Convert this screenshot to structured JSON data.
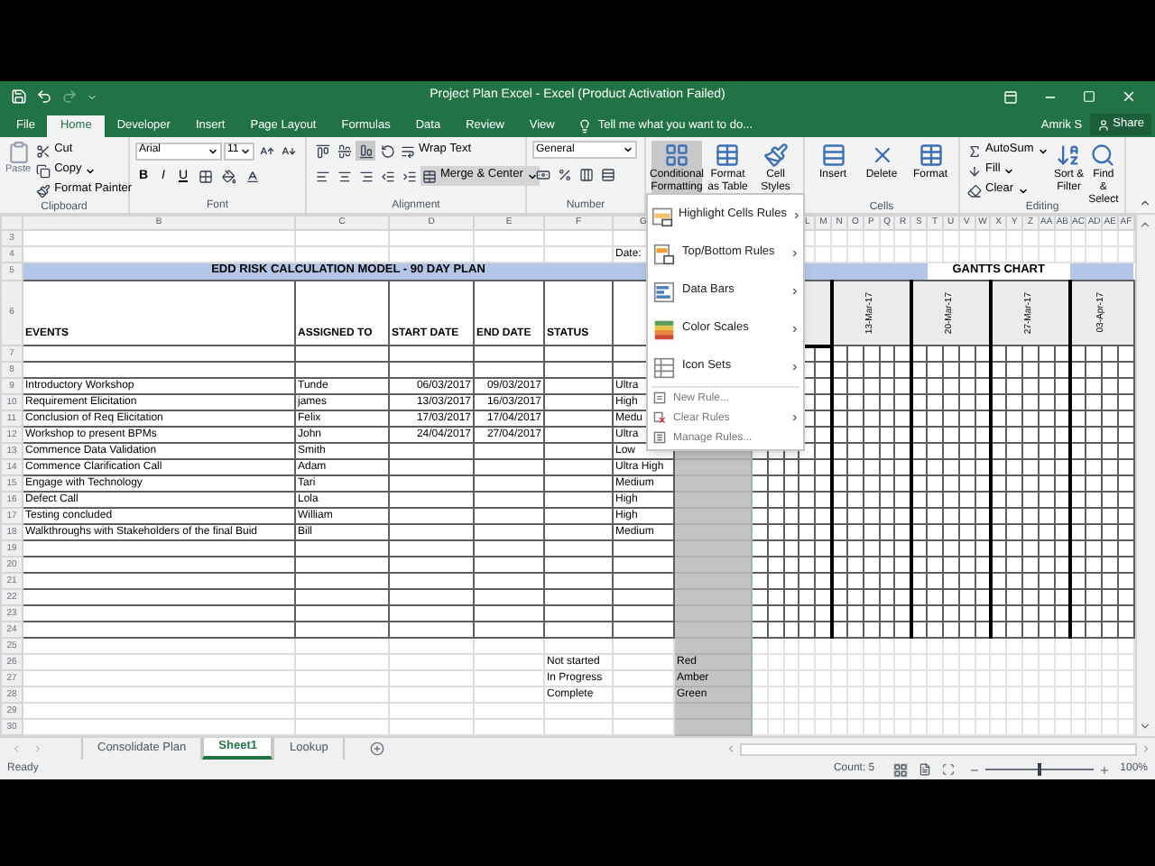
{
  "window": {
    "title": "Project Plan Excel - Excel (Product Activation Failed)",
    "user": "Amrik S",
    "share": "Share"
  },
  "ribbon_tabs": [
    {
      "label": "File",
      "selected": false
    },
    {
      "label": "Home",
      "selected": true
    },
    {
      "label": "Developer",
      "selected": false
    },
    {
      "label": "Insert",
      "selected": false
    },
    {
      "label": "Page Layout",
      "selected": false
    },
    {
      "label": "Formulas",
      "selected": false
    },
    {
      "label": "Data",
      "selected": false
    },
    {
      "label": "Review",
      "selected": false
    },
    {
      "label": "View",
      "selected": false
    }
  ],
  "tell_me": "Tell me what you want to do...",
  "clipboard": {
    "paste": "Paste",
    "cut": "Cut",
    "copy": "Copy",
    "format_painter": "Format Painter",
    "label": "Clipboard"
  },
  "font": {
    "name": "Arial",
    "size": "11",
    "bold": "B",
    "italic": "I",
    "underline": "U",
    "label": "Font"
  },
  "alignment": {
    "wrap_text": "Wrap Text",
    "merge_center": "Merge & Center",
    "label": "Alignment"
  },
  "number": {
    "format": "General",
    "label": "Number"
  },
  "styles": {
    "conditional_formatting": "Conditional Formatting",
    "conditional_formatting_open": true,
    "format_as_table": "Format as Table",
    "cell_styles": "Cell Styles"
  },
  "cells": {
    "insert": "Insert",
    "delete": "Delete",
    "format": "Format",
    "label": "Cells"
  },
  "editing": {
    "autosum": "AutoSum",
    "fill": "Fill",
    "clear": "Clear",
    "sort_filter": "Sort & Filter",
    "find_select": "Find & Select",
    "label": "Editing"
  },
  "cf_menu": [
    {
      "kind": "large",
      "label": "Highlight Cells Rules",
      "submenu": true
    },
    {
      "kind": "large",
      "label": "Top/Bottom Rules",
      "submenu": true
    },
    {
      "kind": "large",
      "label": "Data Bars",
      "submenu": true
    },
    {
      "kind": "large",
      "label": "Color Scales",
      "submenu": true
    },
    {
      "kind": "large",
      "label": "Icon Sets",
      "submenu": true
    },
    {
      "kind": "small",
      "label": "New Rule...",
      "submenu": false
    },
    {
      "kind": "small",
      "label": "Clear Rules",
      "submenu": true
    },
    {
      "kind": "small",
      "label": "Manage Rules...",
      "submenu": false
    }
  ],
  "columns": [
    "B",
    "C",
    "D",
    "E",
    "F",
    "G"
  ],
  "gantt_columns": [
    "L",
    "M",
    "N",
    "O",
    "P",
    "Q",
    "R",
    "S",
    "T",
    "U",
    "V",
    "W",
    "X",
    "Y",
    "Z",
    "AA",
    "AB",
    "AC",
    "AD",
    "AE",
    "AF"
  ],
  "rows": [
    {
      "n": "3",
      "kind": "plain"
    },
    {
      "n": "4",
      "kind": "plain",
      "g": "Date:"
    },
    {
      "n": "5",
      "kind": "title",
      "title": "EDD RISK CALCULATION MODEL - 90 DAY PLAN",
      "gantt_title": "GANTTS CHART"
    },
    {
      "n": "6",
      "kind": "header",
      "b": "EVENTS",
      "c": "ASSIGNED TO",
      "d": "START DATE",
      "e": "END DATE",
      "f": "STATUS",
      "dates": [
        "13-Mar-17",
        "20-Mar-17",
        "27-Mar-17",
        "03-Apr-17"
      ]
    },
    {
      "n": "7",
      "kind": "data"
    },
    {
      "n": "8",
      "kind": "data"
    },
    {
      "n": "9",
      "kind": "data",
      "b": "Introductory Workshop",
      "c": "Tunde",
      "d": "06/03/2017",
      "e": "09/03/2017",
      "g": "Ultra"
    },
    {
      "n": "10",
      "kind": "data",
      "b": "Requirement Elicitation",
      "c": "james",
      "d": "13/03/2017",
      "e": "16/03/2017",
      "g": "High"
    },
    {
      "n": "11",
      "kind": "data",
      "b": "Conclusion of Req Elicitation",
      "c": "Felix",
      "d": "17/03/2017",
      "e": "17/04/2017",
      "g": "Medu"
    },
    {
      "n": "12",
      "kind": "data",
      "b": "Workshop to present BPMs",
      "c": "John",
      "d": "24/04/2017",
      "e": "27/04/2017",
      "g": "Ultra"
    },
    {
      "n": "13",
      "kind": "data",
      "b": "Commence Data Validation",
      "c": "Smith",
      "g": "Low"
    },
    {
      "n": "14",
      "kind": "data",
      "b": "Commence Clarification Call",
      "c": "Adam",
      "g": "Ultra High"
    },
    {
      "n": "15",
      "kind": "data",
      "b": "Engage with Technology",
      "c": "Tari",
      "g": "Medium"
    },
    {
      "n": "16",
      "kind": "data",
      "b": "Defect Call",
      "c": "Lola",
      "g": "High"
    },
    {
      "n": "17",
      "kind": "data",
      "b": "Testing concluded",
      "c": "William",
      "g": "High"
    },
    {
      "n": "18",
      "kind": "data",
      "b": "Walkthroughs with Stakeholders of the final Buid",
      "c": "Bill",
      "g": "Medium"
    },
    {
      "n": "19",
      "kind": "data"
    },
    {
      "n": "20",
      "kind": "data"
    },
    {
      "n": "21",
      "kind": "data"
    },
    {
      "n": "22",
      "kind": "data"
    },
    {
      "n": "23",
      "kind": "data"
    },
    {
      "n": "24",
      "kind": "data"
    },
    {
      "n": "25",
      "kind": "plain"
    },
    {
      "n": "26",
      "kind": "plain",
      "f": "Not started",
      "h": "Red"
    },
    {
      "n": "27",
      "kind": "plain",
      "f": "In Progress",
      "h": "Amber"
    },
    {
      "n": "28",
      "kind": "plain",
      "f": "Complete",
      "h": "Green"
    },
    {
      "n": "29",
      "kind": "plain"
    },
    {
      "n": "30",
      "kind": "plain"
    }
  ],
  "sheet_tabs": [
    {
      "label": "Consolidate Plan",
      "selected": false
    },
    {
      "label": "Sheet1",
      "selected": true
    },
    {
      "label": "Lookup",
      "selected": false
    }
  ],
  "status_bar": {
    "ready": "Ready",
    "count": "Count: 5",
    "zoom": "100%",
    "zoom_slider": {
      "level": 0.5
    }
  }
}
